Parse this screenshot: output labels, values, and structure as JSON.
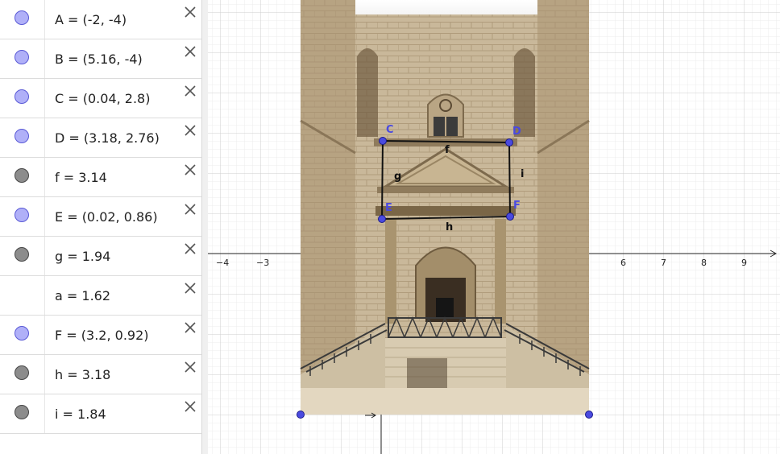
{
  "algebra": {
    "items": [
      {
        "expr": "A = (-2, -4)",
        "marble": "blue"
      },
      {
        "expr": "B = (5.16, -4)",
        "marble": "blue"
      },
      {
        "expr": "C = (0.04, 2.8)",
        "marble": "blue"
      },
      {
        "expr": "D = (3.18, 2.76)",
        "marble": "blue"
      },
      {
        "expr": "f = 3.14",
        "marble": "grey"
      },
      {
        "expr": "E = (0.02, 0.86)",
        "marble": "blue"
      },
      {
        "expr": "g = 1.94",
        "marble": "grey"
      },
      {
        "expr": "a = 1.62",
        "marble": "none"
      },
      {
        "expr": "F = (3.2, 0.92)",
        "marble": "blue"
      },
      {
        "expr": "h = 3.18",
        "marble": "grey"
      },
      {
        "expr": "i = 1.84",
        "marble": "grey"
      }
    ]
  },
  "graphics": {
    "x_tick_labels": [
      "−4",
      "−3",
      "6",
      "7",
      "8",
      "9"
    ],
    "point_labels": {
      "C": "C",
      "D": "D",
      "E": "E",
      "F": "F"
    },
    "segment_labels": {
      "f": "f",
      "g": "g",
      "h": "h",
      "i": "i"
    },
    "colors": {
      "point": "#4a4ae0",
      "marble_blue": "#b0b0f8",
      "marble_grey": "#8c8c8c",
      "segment": "#111111"
    }
  }
}
